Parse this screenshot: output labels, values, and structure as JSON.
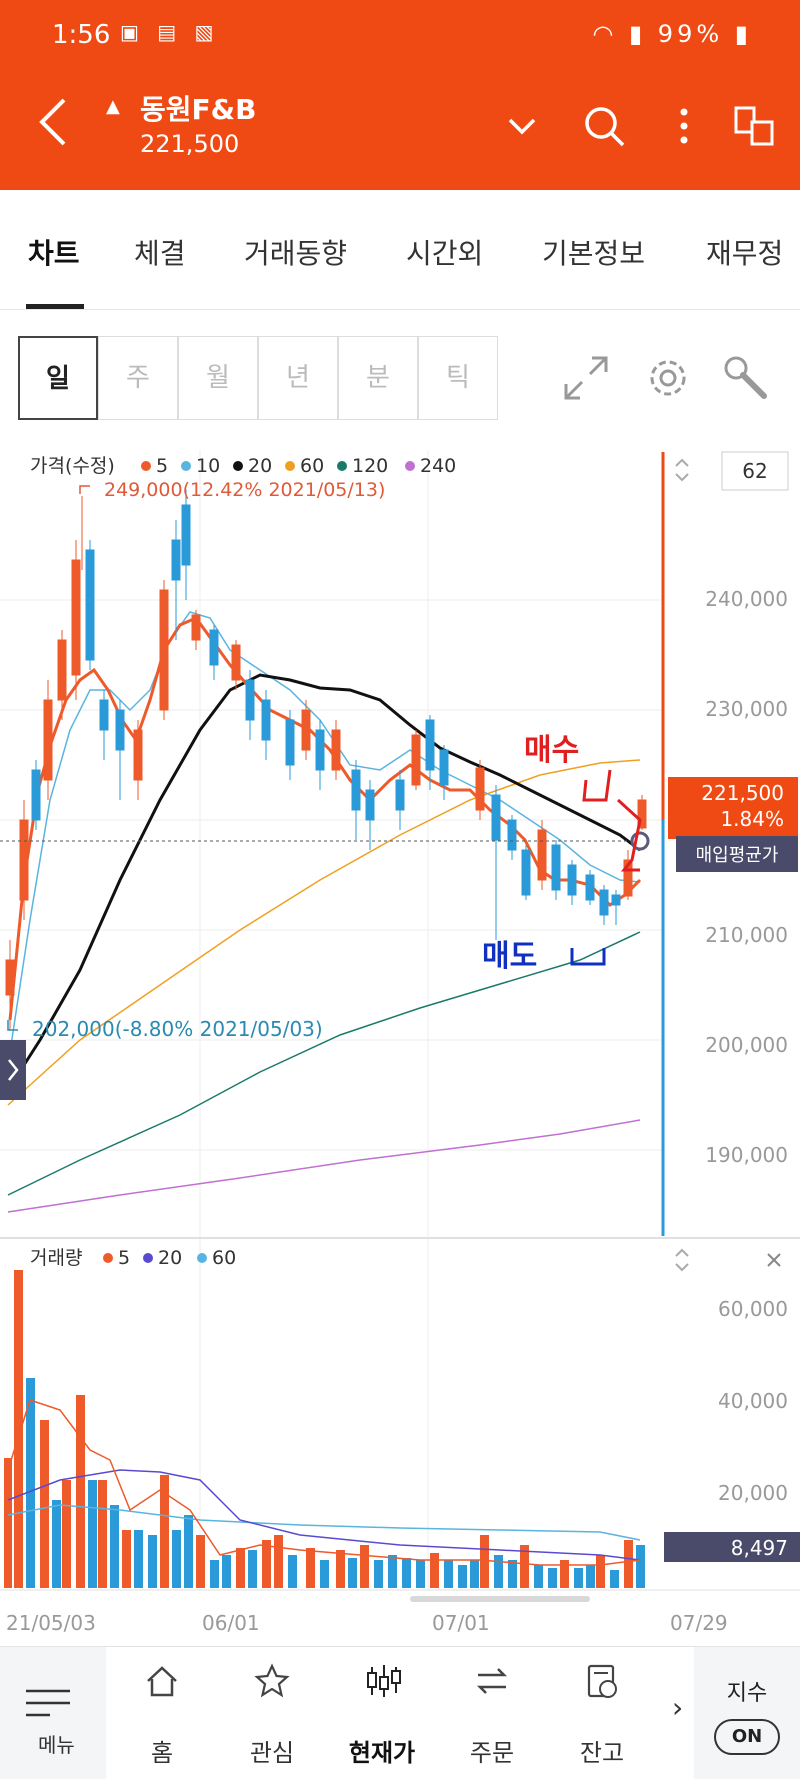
{
  "status_bar": {
    "time": "1:56",
    "battery": "99%"
  },
  "app_bar": {
    "stock_name": "동원F&B",
    "price": "221,500"
  },
  "tabs": [
    {
      "label": "차트",
      "active": true
    },
    {
      "label": "체결"
    },
    {
      "label": "거래동향"
    },
    {
      "label": "시간외"
    },
    {
      "label": "기본정보"
    },
    {
      "label": "재무정"
    }
  ],
  "periods": [
    {
      "label": "일",
      "active": true
    },
    {
      "label": "주"
    },
    {
      "label": "월"
    },
    {
      "label": "년"
    },
    {
      "label": "분"
    },
    {
      "label": "틱"
    }
  ],
  "price_chart": {
    "legend_title": "가격(수정)",
    "legend": [
      {
        "label": "5",
        "color": "#ee5a2a"
      },
      {
        "label": "10",
        "color": "#5ab4e0"
      },
      {
        "label": "20",
        "color": "#111111"
      },
      {
        "label": "60",
        "color": "#f0a020"
      },
      {
        "label": "120",
        "color": "#1a7a6a"
      },
      {
        "label": "240",
        "color": "#c070d0"
      }
    ],
    "count_box": "62",
    "max_note": "249,000(12.42% 2021/05/13)",
    "min_note": "202,000(-8.80% 2021/05/03)",
    "y_ticks": [
      "240,000",
      "230,000",
      "210,000",
      "200,000",
      "190,000"
    ],
    "current_price": "221,500",
    "current_change": "1.84%",
    "avg_label": "매입평균가",
    "annotation_buy": "매수",
    "annotation_sell": "매도"
  },
  "volume_chart": {
    "legend_title": "거래량",
    "legend": [
      {
        "label": "5",
        "color": "#ee5a2a"
      },
      {
        "label": "20",
        "color": "#5a4ad0"
      },
      {
        "label": "60",
        "color": "#5ab4e0"
      }
    ],
    "y_ticks": [
      "60,000",
      "40,000",
      "20,000"
    ],
    "current_volume": "8,497"
  },
  "x_axis": [
    "21/05/03",
    "06/01",
    "07/01",
    "07/29"
  ],
  "bottom_nav": {
    "menu": "메뉴",
    "items": [
      {
        "label": "홈",
        "icon": "home-icon"
      },
      {
        "label": "관심",
        "icon": "star-icon"
      },
      {
        "label": "현재가",
        "icon": "candle-icon",
        "active": true
      },
      {
        "label": "주문",
        "icon": "swap-icon"
      },
      {
        "label": "잔고",
        "icon": "wallet-icon"
      }
    ],
    "index_label": "지수",
    "index_toggle": "ON"
  }
}
